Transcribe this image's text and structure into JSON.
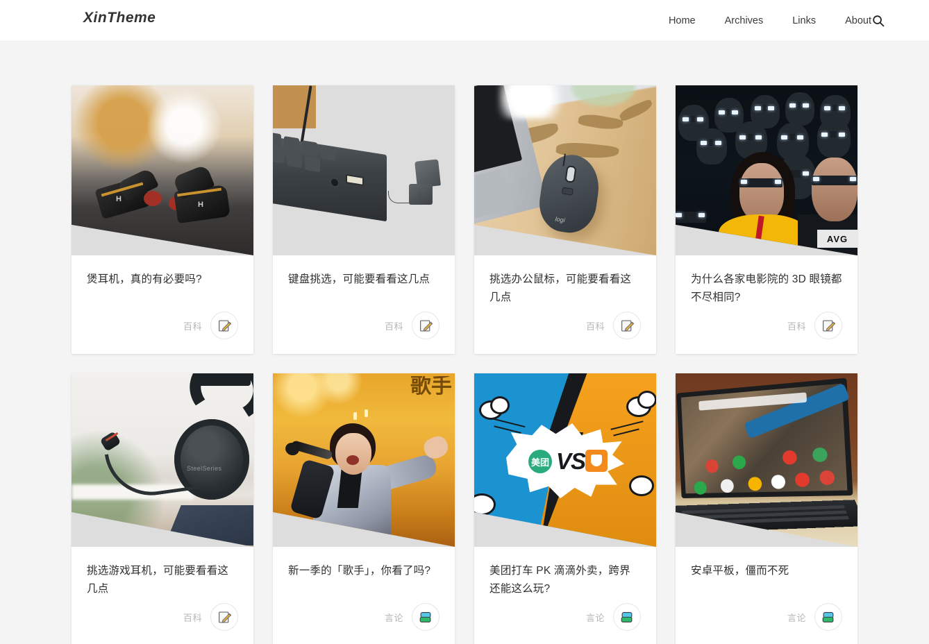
{
  "header": {
    "logo": "XinTheme",
    "nav": [
      {
        "label": "Home"
      },
      {
        "label": "Archives"
      },
      {
        "label": "Links"
      },
      {
        "label": "About"
      }
    ],
    "search_icon": "search-icon"
  },
  "cards": [
    {
      "title": "煲耳机，真的有必要吗?",
      "category": "百科",
      "icon": "memo-icon",
      "image_alt": "black-and-gold in-ear earphones on a dark desk"
    },
    {
      "title": "键盘挑选，可能要看看这几点",
      "category": "百科",
      "icon": "memo-icon",
      "image_alt": "dark mechanical keyboard with usb port on a white desk"
    },
    {
      "title": "挑选办公鼠标，可能要看看这几点",
      "category": "百科",
      "icon": "memo-icon",
      "image_alt": "logitech mouse beside a laptop on a wooden desk"
    },
    {
      "title": "为什么各家电影院的 3D 眼镜都不尽相同?",
      "category": "百科",
      "icon": "memo-icon",
      "image_alt": "cinema audience wearing 3d glasses in the dark"
    },
    {
      "title": "挑选游戏耳机，可能要看看这几点",
      "category": "百科",
      "icon": "memo-icon",
      "image_alt": "steelseries gaming headset with boom microphone"
    },
    {
      "title": "新一季的「歌手」，你看了吗?",
      "category": "言论",
      "icon": "speech-bubbles-icon",
      "image_alt": "singer performing on a golden lit stage"
    },
    {
      "title": "美团打车 PK 滴滴外卖，跨界还能这么玩?",
      "category": "言论",
      "icon": "speech-bubbles-icon",
      "image_alt": "comic style meituan vs didi versus graphic",
      "art_text": {
        "left_logo": "美团",
        "vs": "VS"
      }
    },
    {
      "title": "安卓平板，僵而不死",
      "category": "言论",
      "icon": "speech-bubbles-icon",
      "image_alt": "android tablet with keyboard dock showing home screen"
    }
  ],
  "colors": {
    "page_background": "#f4f4f4",
    "header_background": "#ffffff",
    "card_background": "#ffffff",
    "title_text": "#2f2f2f",
    "category_text": "#b6b6b6",
    "nav_text": "#3a3a3a"
  }
}
